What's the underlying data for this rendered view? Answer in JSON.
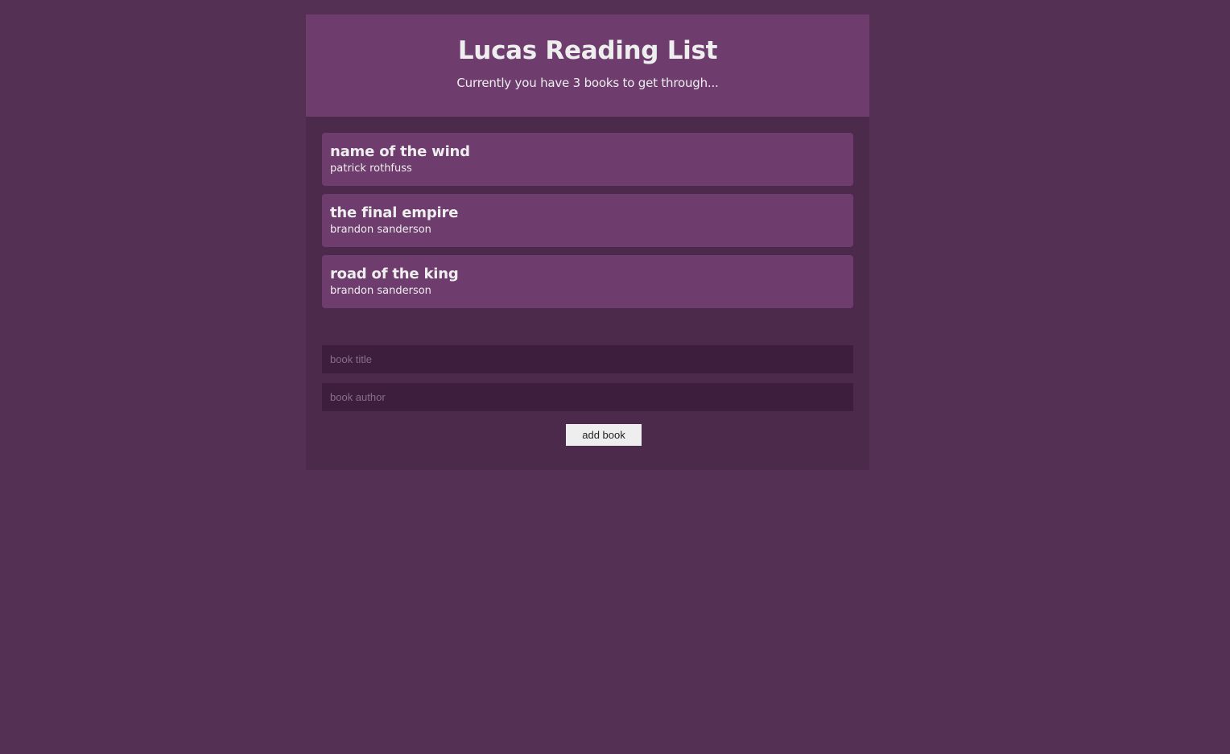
{
  "navbar": {
    "title": "Lucas Reading List",
    "subtitle": "Currently you have 3 books to get through..."
  },
  "books": [
    {
      "title": "name of the wind",
      "author": "patrick rothfuss"
    },
    {
      "title": "the final empire",
      "author": "brandon sanderson"
    },
    {
      "title": "road of the king",
      "author": "brandon sanderson"
    }
  ],
  "form": {
    "title_placeholder": "book title",
    "title_value": "",
    "author_placeholder": "book author",
    "author_value": "",
    "submit_label": "add book"
  },
  "colors": {
    "page_background": "#553055",
    "panel_background": "#4c2a4c",
    "card_background": "#6e3d6e",
    "input_background": "#3d1f3d",
    "text": "#eeeeee"
  }
}
